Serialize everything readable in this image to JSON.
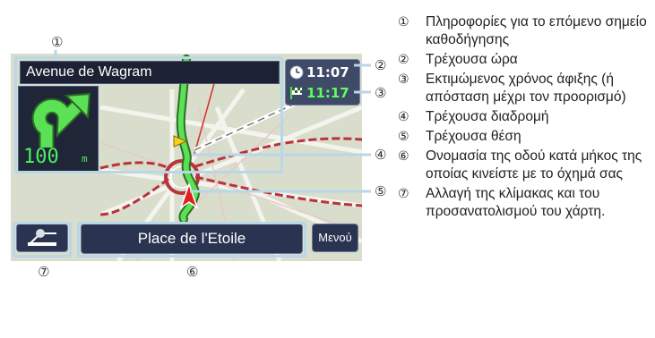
{
  "callouts": {
    "c1": "①",
    "c2": "②",
    "c3": "③",
    "c4": "④",
    "c5": "⑤",
    "c6": "⑥",
    "c7": "⑦"
  },
  "screen": {
    "street_name": "Avenue de Wagram",
    "distance_value": "100",
    "distance_unit": "m",
    "current_time": "11:07",
    "eta": "11:17",
    "current_street": "Place de l'Etoile",
    "menu_label": "Μενού",
    "icons": {
      "turn": "right-turn-arrow-icon",
      "clock": "clock-icon",
      "eta": "checkered-flag-icon",
      "view": "map-view-icon",
      "position": "current-position-arrow-icon"
    },
    "colors": {
      "route": "#5ce055",
      "distance_text": "#4cf060",
      "panel_bg": "#2a3350",
      "highlight": "#b9d7e6"
    }
  },
  "legend": [
    {
      "num": "①",
      "text": "Πληροφορίες για το επόμενο σημείο καθοδήγησης"
    },
    {
      "num": "②",
      "text": "Τρέχουσα ώρα"
    },
    {
      "num": "③",
      "text": "Εκτιμώμενος χρόνος άφιξης (ή απόσταση μέχρι τον προορισμό)"
    },
    {
      "num": "④",
      "text": "Τρέχουσα διαδρομή"
    },
    {
      "num": "⑤",
      "text": "Τρέχουσα θέση"
    },
    {
      "num": "⑥",
      "text": "Ονομασία της οδού κατά μήκος της οποίας κινείστε με το όχημά σας"
    },
    {
      "num": "⑦",
      "text": "Αλλαγή της κλίμακας και του προσανατολισμού του χάρτη."
    }
  ]
}
